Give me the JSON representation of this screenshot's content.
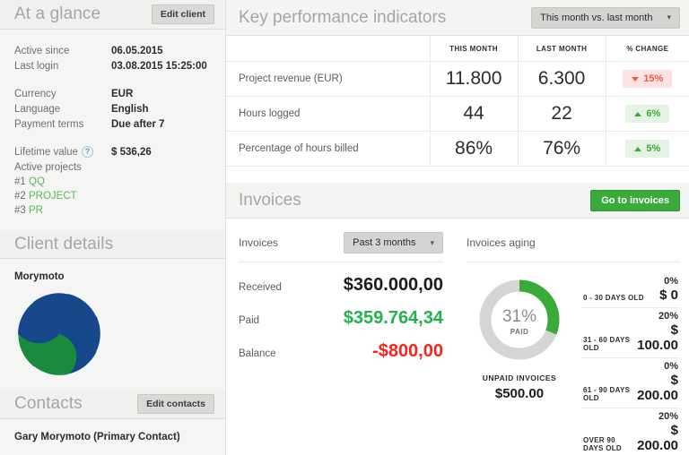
{
  "at_a_glance": {
    "title": "At a glance",
    "edit_button": "Edit client",
    "fields": [
      {
        "key": "Active since",
        "value": "06.05.2015"
      },
      {
        "key": "Last login",
        "value": "03.08.2015 15:25:00"
      }
    ],
    "fields2": [
      {
        "key": "Currency",
        "value": "EUR"
      },
      {
        "key": "Language",
        "value": "English"
      },
      {
        "key": "Payment terms",
        "value": "Due after 7"
      }
    ],
    "lifetime_value_label": "Lifetime value",
    "lifetime_value_help": "?",
    "lifetime_value": "$ 536,26",
    "active_projects_label": "Active projects",
    "projects": [
      {
        "num": "#1",
        "name": "QQ"
      },
      {
        "num": "#2",
        "name": "PROJECT"
      },
      {
        "num": "#3",
        "name": "PR"
      }
    ]
  },
  "client_details": {
    "title": "Client details",
    "client_name": "Morymoto",
    "logo_colors": {
      "blue": "#17478b",
      "green": "#1a8a3c"
    }
  },
  "contacts": {
    "title": "Contacts",
    "edit_button": "Edit contacts",
    "primary": "Gary Morymoto (Primary Contact)"
  },
  "kpi": {
    "title": "Key performance indicators",
    "period_select": "This month vs. last month",
    "caret": "⌄",
    "columns": [
      "",
      "THIS MONTH",
      "LAST MONTH",
      "% CHANGE"
    ],
    "rows": [
      {
        "label": "Project revenue (EUR)",
        "this_month": "11.800",
        "last_month": "6.300",
        "change": "15%",
        "direction": "down"
      },
      {
        "label": "Hours logged",
        "this_month": "44",
        "last_month": "22",
        "change": "6%",
        "direction": "up"
      },
      {
        "label": "Percentage of hours billed",
        "this_month": "86%",
        "last_month": "76%",
        "change": "5%",
        "direction": "up"
      }
    ]
  },
  "invoices": {
    "title": "Invoices",
    "go_button": "Go to invoices",
    "left_label": "Invoices",
    "range_select": "Past 3 months",
    "aging_label": "Invoices aging",
    "rows": [
      {
        "key": "Received",
        "value": "$360.000,00",
        "color": "black"
      },
      {
        "key": "Paid",
        "value": "$359.764,34",
        "color": "green"
      },
      {
        "key": "Balance",
        "value": "-$800,00",
        "color": "red"
      }
    ],
    "donut": {
      "percent_label": "31%",
      "percent_value": 31,
      "sub_label": "PAID",
      "arc_color": "#3aab3a",
      "track_color": "#d5d5d3"
    },
    "unpaid_label": "UNPAID INVOICES",
    "unpaid_value": "$500.00",
    "aging": [
      {
        "label": "0 - 30 DAYS OLD",
        "pct": "0%",
        "amount": "$ 0"
      },
      {
        "label": "31 - 60 DAYS OLD",
        "pct": "20%",
        "amount": "$ 100.00"
      },
      {
        "label": "61 - 90 DAYS OLD",
        "pct": "0%",
        "amount": "$ 200.00"
      },
      {
        "label": "OVER 90 DAYS OLD",
        "pct": "20%",
        "amount": "$ 200.00"
      }
    ]
  }
}
